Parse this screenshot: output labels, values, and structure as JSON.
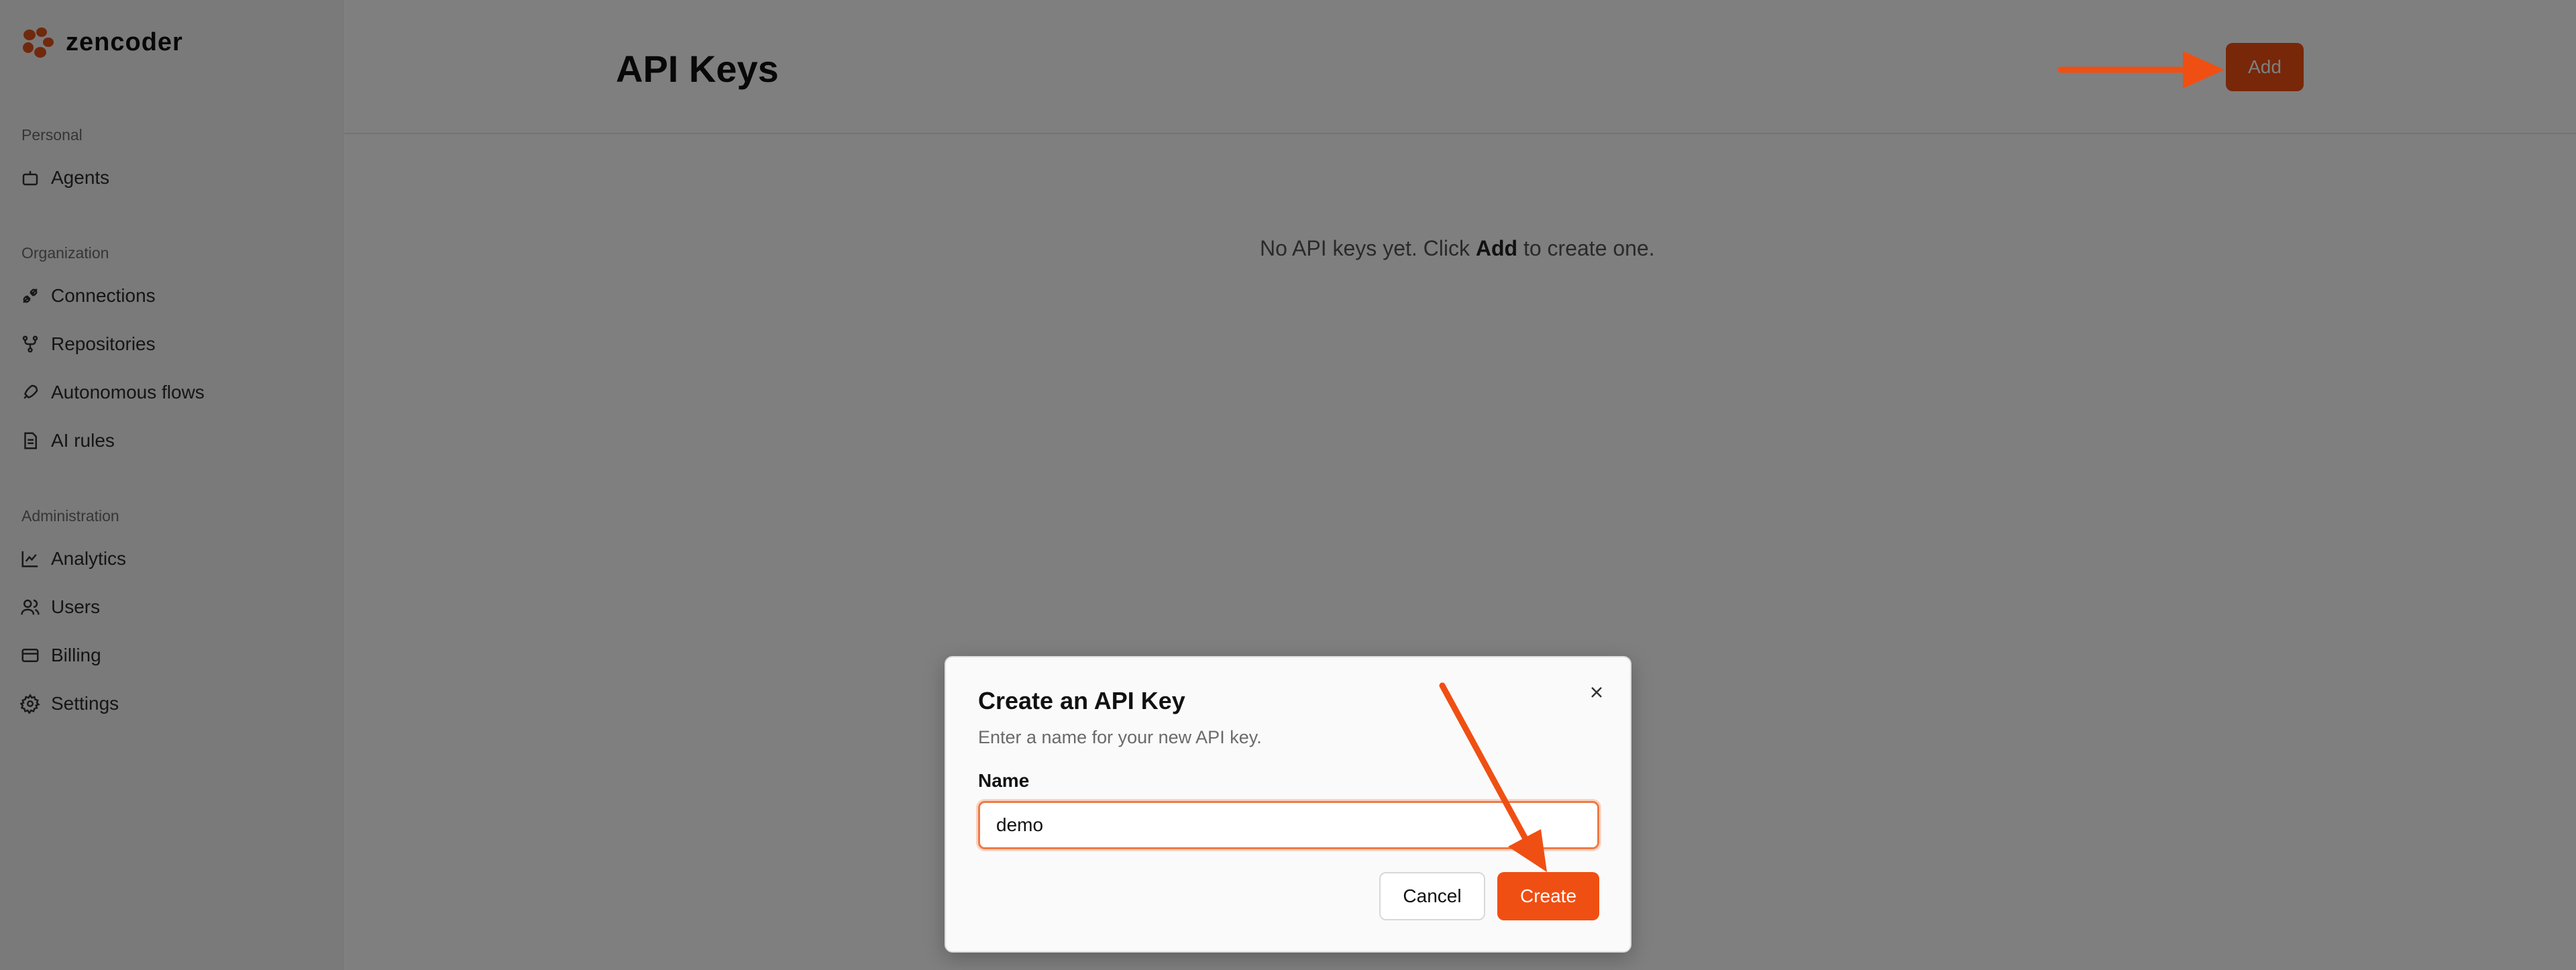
{
  "app": {
    "name": "zencoder"
  },
  "sidebar": {
    "sections": [
      {
        "label": "Personal"
      },
      {
        "label": "Organization"
      },
      {
        "label": "Administration"
      }
    ],
    "items": [
      {
        "label": "Agents",
        "icon": "bot-icon"
      },
      {
        "label": "Connections",
        "icon": "plug-icon"
      },
      {
        "label": "Repositories",
        "icon": "git-branch-icon"
      },
      {
        "label": "Autonomous flows",
        "icon": "rocket-icon"
      },
      {
        "label": "AI rules",
        "icon": "file-text-icon"
      },
      {
        "label": "Analytics",
        "icon": "line-chart-icon"
      },
      {
        "label": "Users",
        "icon": "users-icon"
      },
      {
        "label": "Billing",
        "icon": "credit-card-icon"
      },
      {
        "label": "Settings",
        "icon": "gear-icon"
      }
    ]
  },
  "header": {
    "title": "API Keys",
    "add_label": "Add"
  },
  "main": {
    "empty_prefix": "No API keys yet. Click ",
    "empty_bold": "Add",
    "empty_suffix": " to create one."
  },
  "dialog": {
    "title": "Create an API Key",
    "description": "Enter a name for your new API key.",
    "name_label": "Name",
    "name_value": "demo",
    "cancel_label": "Cancel",
    "create_label": "Create"
  },
  "colors": {
    "accent": "#f04f13",
    "annotation_arrow": "#f04f13",
    "overlay": "rgba(0,0,0,0.5)"
  }
}
